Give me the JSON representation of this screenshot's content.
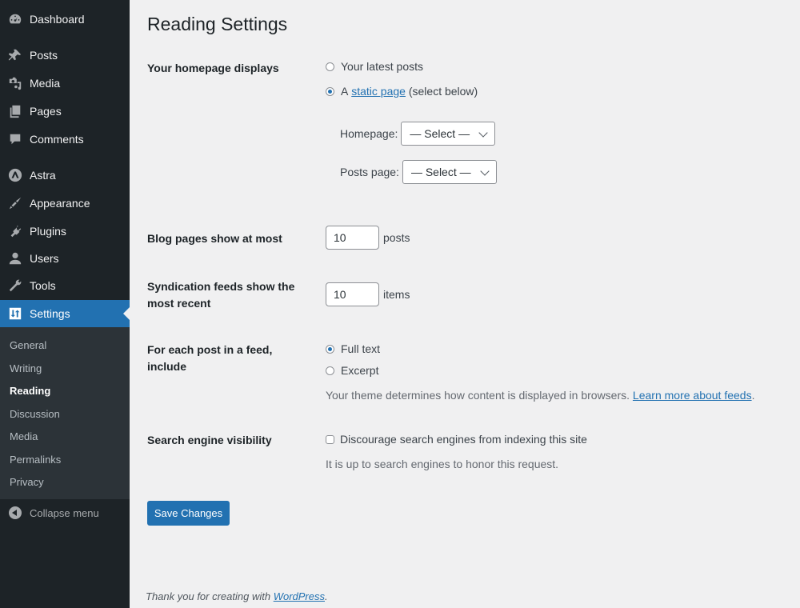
{
  "sidebar": {
    "items": [
      {
        "label": "Dashboard",
        "icon": "dashboard-icon"
      },
      {
        "label": "Posts",
        "icon": "pin-icon"
      },
      {
        "label": "Media",
        "icon": "media-icon"
      },
      {
        "label": "Pages",
        "icon": "pages-icon"
      },
      {
        "label": "Comments",
        "icon": "comment-icon"
      },
      {
        "label": "Astra",
        "icon": "astra-icon"
      },
      {
        "label": "Appearance",
        "icon": "paintbrush-icon"
      },
      {
        "label": "Plugins",
        "icon": "plug-icon"
      },
      {
        "label": "Users",
        "icon": "user-icon"
      },
      {
        "label": "Tools",
        "icon": "wrench-icon"
      },
      {
        "label": "Settings",
        "icon": "settings-icon",
        "active": true
      }
    ],
    "submenu": [
      "General",
      "Writing",
      "Reading",
      "Discussion",
      "Media",
      "Permalinks",
      "Privacy"
    ],
    "current_submenu": "Reading",
    "collapse_label": "Collapse menu"
  },
  "page": {
    "title": "Reading Settings",
    "homepage_displays": {
      "label": "Your homepage displays",
      "option_latest": "Your latest posts",
      "option_static_prefix": "A",
      "option_static_link": "static page",
      "option_static_suffix": "(select below)",
      "selected": "static",
      "homepage_label": "Homepage:",
      "homepage_value": "— Select —",
      "posts_page_label": "Posts page:",
      "posts_page_value": "— Select —"
    },
    "blog_pages": {
      "label": "Blog pages show at most",
      "value": "10",
      "unit": "posts"
    },
    "syndication": {
      "label": "Syndication feeds show the most recent",
      "value": "10",
      "unit": "items"
    },
    "feed_include": {
      "label": "For each post in a feed, include",
      "option_full": "Full text",
      "option_excerpt": "Excerpt",
      "selected": "full",
      "description": "Your theme determines how content is displayed in browsers.",
      "link": "Learn more about feeds",
      "link_suffix": "."
    },
    "search_visibility": {
      "label": "Search engine visibility",
      "checkbox_label": "Discourage search engines from indexing this site",
      "checked": false,
      "description": "It is up to search engines to honor this request."
    },
    "save_label": "Save Changes"
  },
  "footer": {
    "text": "Thank you for creating with",
    "link": "WordPress",
    "suffix": "."
  }
}
